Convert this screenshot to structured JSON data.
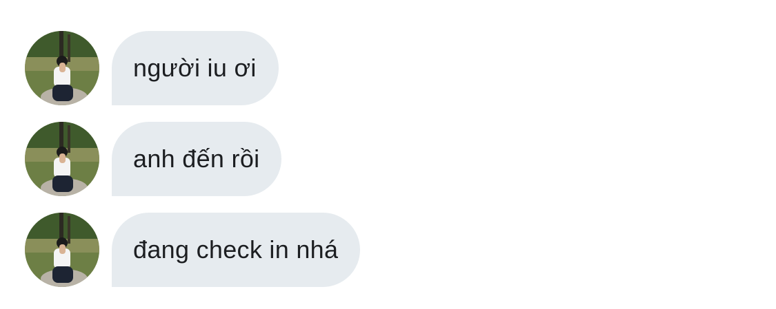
{
  "messages": [
    {
      "text": "người iu ơi"
    },
    {
      "text": "anh đến rồi"
    },
    {
      "text": "đang check in nhá"
    }
  ],
  "avatar": {
    "icon": "profile-photo",
    "description_colors": {
      "grass": "#5e7a3a",
      "trees": "#3f5a2c",
      "shirt": "#f4f4f4",
      "pants": "#1d2433",
      "hair": "#1b1b1b",
      "skin": "#d9b394",
      "rock": "#b8b2a6"
    }
  },
  "colors": {
    "bubble": "#e6ebef",
    "text": "#1c1e21",
    "background": "#ffffff"
  }
}
